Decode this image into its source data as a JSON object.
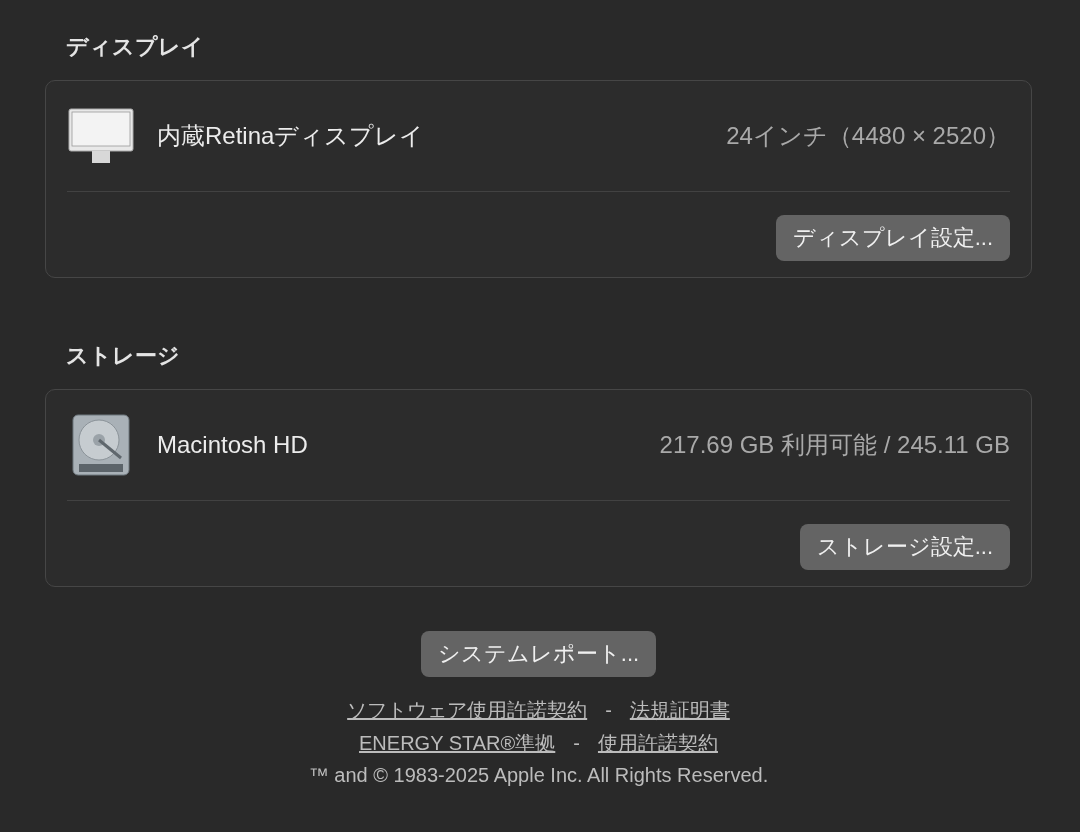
{
  "sections": [
    {
      "title": "ディスプレイ",
      "device": {
        "kind": "display",
        "name": "内蔵Retinaディスプレイ",
        "detail": "24インチ（4480 × 2520）"
      },
      "button": "ディスプレイ設定..."
    },
    {
      "title": "ストレージ",
      "device": {
        "kind": "disk",
        "name": "Macintosh HD",
        "detail": "217.69 GB 利用可能 / 245.11 GB"
      },
      "button": "ストレージ設定..."
    }
  ],
  "system_report_button": "システムレポート...",
  "footer_lines": [
    {
      "links": [
        "ソフトウェア使用許諾契約",
        "法規証明書"
      ],
      "separator": "-"
    },
    {
      "links": [
        "ENERGY STAR®準拠",
        "使用許諾契約"
      ],
      "separator": "-"
    }
  ],
  "copyright": "™ and © 1983-2025 Apple Inc. All Rights Reserved."
}
